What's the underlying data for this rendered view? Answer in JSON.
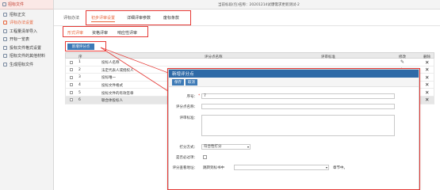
{
  "sidebar": {
    "header": "招标文件",
    "items": [
      {
        "label": "招标正文",
        "active": false
      },
      {
        "label": "评标办法设置",
        "active": true
      },
      {
        "label": "工程量清单导入",
        "active": false
      },
      {
        "label": "开标一览表",
        "active": false
      },
      {
        "label": "投标文件格式设置",
        "active": false
      },
      {
        "label": "招标文件的其他材料",
        "active": false
      },
      {
        "label": "生成招标文件",
        "active": false
      }
    ]
  },
  "topbar": {
    "info": "当前标段(包)名称：20201214试爆需求更新测试-2"
  },
  "tabs_level1": {
    "label": "评标办法",
    "tabs": [
      {
        "label": "初步评审设置",
        "active": true
      },
      {
        "label": "详细评审参数",
        "active": false
      },
      {
        "label": "废标条款",
        "active": false
      }
    ]
  },
  "tabs_level2": {
    "tabs": [
      {
        "label": "形式评审",
        "active": true
      },
      {
        "label": "资格评审",
        "active": false
      },
      {
        "label": "响应性评审",
        "active": false
      }
    ]
  },
  "toolbar": {
    "add_label": "新增评分点"
  },
  "table": {
    "headers": {
      "no": "序",
      "name": "评分点名称",
      "standard": "评审标准",
      "edit": "修改",
      "delete": "删除"
    },
    "rows": [
      {
        "no": "1",
        "name": "投标人名称"
      },
      {
        "no": "2",
        "name": "法定代表人或授权人"
      },
      {
        "no": "3",
        "name": "投标唯一"
      },
      {
        "no": "4",
        "name": "投标文件格式"
      },
      {
        "no": "5",
        "name": "投标文件的有效签章"
      },
      {
        "no": "6",
        "name": "联合体投标人"
      }
    ],
    "edit_icon": "pencil-icon",
    "delete_icon": "close-icon"
  },
  "dialog": {
    "title": "新增评分点",
    "save_label": "保存",
    "cancel_label": "取消",
    "fields": {
      "seq_label": "序号：",
      "seq_value": "7",
      "name_label": "评分点名称：",
      "name_value": "",
      "standard_label": "评审标准：",
      "method_label": "打分方式：",
      "method_value": "符合性打分",
      "required_label": "是否必过项：",
      "link_label": "评分查看地址：",
      "link_prefix": "跳转到标书中",
      "link_value": "",
      "link_suffix": "章节中。"
    }
  },
  "colors": {
    "accent": "#e8663d",
    "primary_blue": "#3d7ab6",
    "dialog_header": "#2e6aa7",
    "highlight_red": "#e53935"
  }
}
